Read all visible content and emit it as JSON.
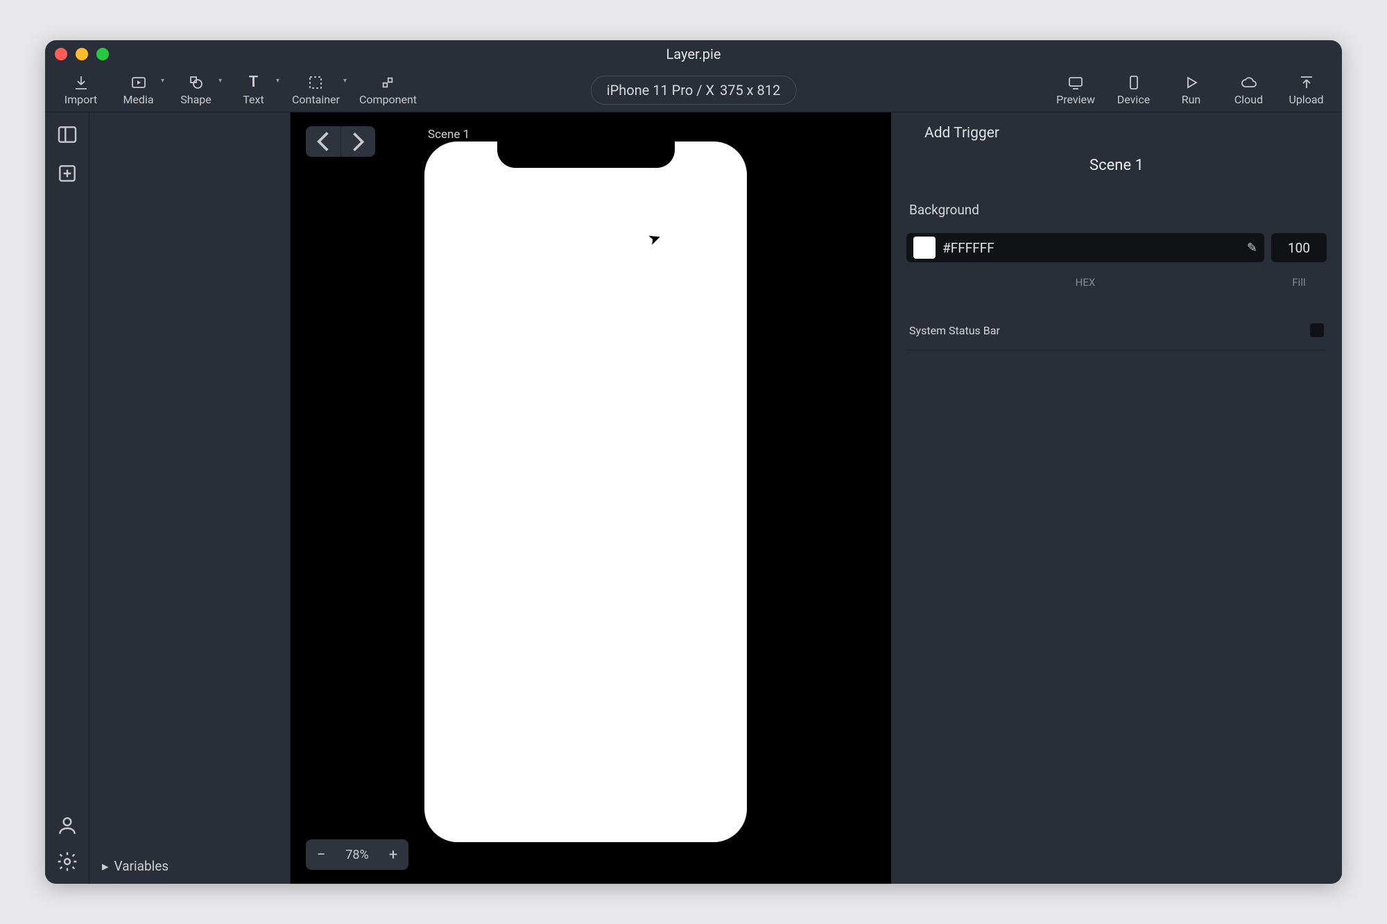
{
  "window": {
    "title": "Layer.pie"
  },
  "toolbar": {
    "import": "Import",
    "media": "Media",
    "shape": "Shape",
    "text": "Text",
    "container": "Container",
    "component": "Component",
    "preview": "Preview",
    "device": "Device",
    "run": "Run",
    "cloud": "Cloud",
    "upload": "Upload"
  },
  "device_chip": {
    "name": "iPhone 11 Pro / X",
    "dimensions": "375 x 812"
  },
  "sidepanel": {
    "variables": "Variables"
  },
  "canvas": {
    "scene_label": "Scene 1",
    "zoom": "78%"
  },
  "inspector": {
    "add_trigger": "Add Trigger",
    "scene_name": "Scene 1",
    "background_label": "Background",
    "hex_value": "#FFFFFF",
    "hex_sub": "HEX",
    "fill_value": "100",
    "fill_sub": "Fill",
    "status_bar_label": "System Status Bar"
  }
}
